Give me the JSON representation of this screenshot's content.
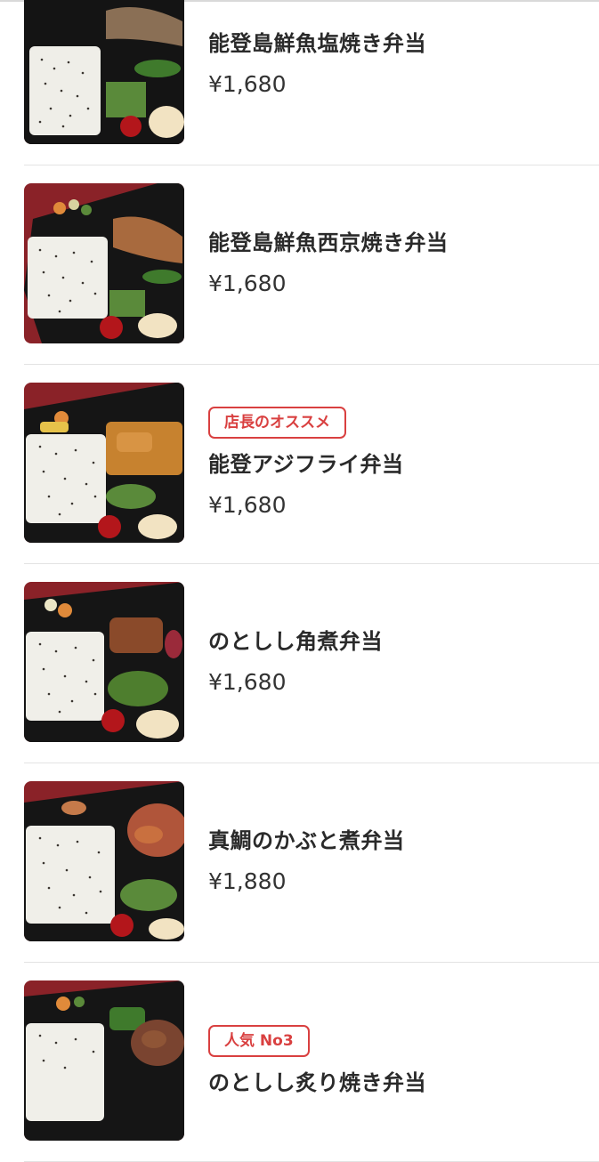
{
  "menu": {
    "items": [
      {
        "name": "能登島鮮魚塩焼き弁当",
        "price": "¥1,680",
        "badge": "",
        "image_icon": "bento-photo"
      },
      {
        "name": "能登島鮮魚西京焼き弁当",
        "price": "¥1,680",
        "badge": "",
        "image_icon": "bento-photo"
      },
      {
        "name": "能登アジフライ弁当",
        "price": "¥1,680",
        "badge": "店長のオススメ",
        "image_icon": "bento-photo"
      },
      {
        "name": "のとしし角煮弁当",
        "price": "¥1,680",
        "badge": "",
        "image_icon": "bento-photo"
      },
      {
        "name": "真鯛のかぶと煮弁当",
        "price": "¥1,880",
        "badge": "",
        "image_icon": "bento-photo"
      },
      {
        "name": "のとしし炙り焼き弁当",
        "price": "",
        "badge": "人気 No3",
        "image_icon": "bento-photo"
      }
    ]
  },
  "colors": {
    "badge": "#d94040",
    "divider": "#e3e3e3",
    "tray": "#1a1a1a",
    "background": "#ffffff"
  }
}
